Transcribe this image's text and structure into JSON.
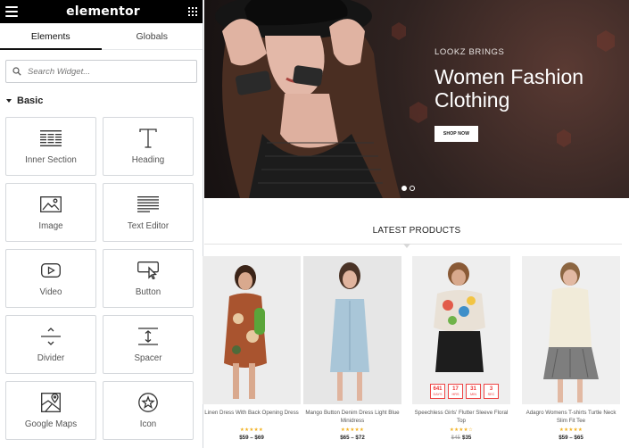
{
  "panel": {
    "logo": "elementor",
    "tabs": [
      {
        "label": "Elements"
      },
      {
        "label": "Globals"
      }
    ],
    "search": {
      "placeholder": "Search Widget..."
    },
    "category": "Basic",
    "widgets": [
      {
        "label": "Inner Section",
        "icon": "inner-section-icon"
      },
      {
        "label": "Heading",
        "icon": "heading-icon"
      },
      {
        "label": "Image",
        "icon": "image-icon"
      },
      {
        "label": "Text Editor",
        "icon": "text-editor-icon"
      },
      {
        "label": "Video",
        "icon": "video-icon"
      },
      {
        "label": "Button",
        "icon": "button-icon"
      },
      {
        "label": "Divider",
        "icon": "divider-icon"
      },
      {
        "label": "Spacer",
        "icon": "spacer-icon"
      },
      {
        "label": "Google Maps",
        "icon": "google-maps-icon"
      },
      {
        "label": "Icon",
        "icon": "star-icon"
      }
    ]
  },
  "hero": {
    "subtitle": "LOOKZ BRINGS",
    "title": "Women Fashion Clothing",
    "button": "SHOP NOW",
    "slides": 2,
    "active_slide": 1
  },
  "products": {
    "heading": "LATEST PRODUCTS",
    "items": [
      {
        "name": "Linen Dress With Back Opening Dress",
        "rating": "★★★★★",
        "price": "$59 – $69",
        "old_price": ""
      },
      {
        "name": "Mango Button Denim Dress Light Blue Minidress",
        "rating": "★★★★★",
        "price": "$65 – $72",
        "old_price": ""
      },
      {
        "name": "Speechless Girls' Flutter Sleeve Floral Top",
        "rating": "★★★★☆",
        "price": "$35",
        "old_price": "$45",
        "countdown": [
          {
            "value": "641",
            "unit": "DAYS"
          },
          {
            "value": "17",
            "unit": "HRS"
          },
          {
            "value": "31",
            "unit": "MIN"
          },
          {
            "value": "3",
            "unit": "SEC"
          }
        ]
      },
      {
        "name": "Adagro Womens T-shirts Turtle Neck Slim Fit Tee",
        "rating": "★★★★★",
        "price": "$59 – $65",
        "old_price": ""
      }
    ]
  },
  "colors": {
    "panel_topbar": "#000000",
    "star": "#f2b01e",
    "countdown": "#ee3333"
  }
}
